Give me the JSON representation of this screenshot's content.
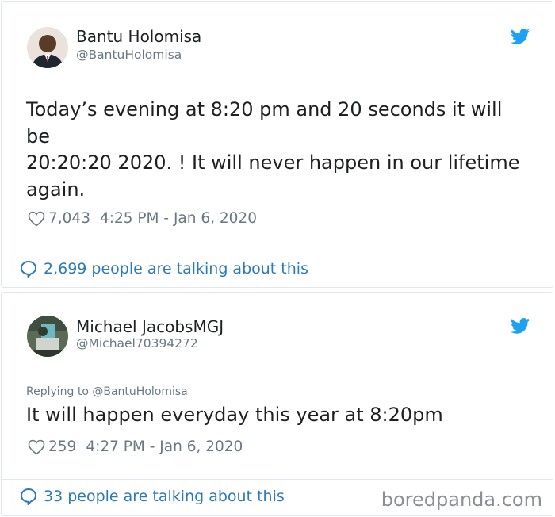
{
  "tweet1": {
    "author_name": "Bantu Holomisa",
    "author_handle": "@BantuHolomisa",
    "text_lines": [
      "Today’s evening at 8:20 pm and 20 seconds it will",
      "be",
      "20:20:20 2020. ! It will never happen in our lifetime",
      "again."
    ],
    "likes": "7,043",
    "timestamp": "4:25 PM - Jan 6, 2020",
    "talking": "2,699 people are talking about this"
  },
  "tweet2": {
    "author_name": "Michael JacobsMGJ",
    "author_handle": "@Michael70394272",
    "replying_to": "Replying to @BantuHolomisa",
    "text_lines": [
      "It will happen everyday this year at 8:20pm"
    ],
    "likes": "259",
    "timestamp": "4:27 PM - Jan 6, 2020",
    "talking": "33 people are talking about this"
  },
  "watermark": "boredpanda.com",
  "colors": {
    "twitter_blue": "#1da1f2",
    "link_blue": "#2b7bb9",
    "muted_gray": "#697882",
    "border": "#e1e8ed"
  },
  "icons": {
    "bird": "twitter-bird-icon",
    "heart": "heart-icon",
    "bubble": "speech-bubble-icon"
  }
}
